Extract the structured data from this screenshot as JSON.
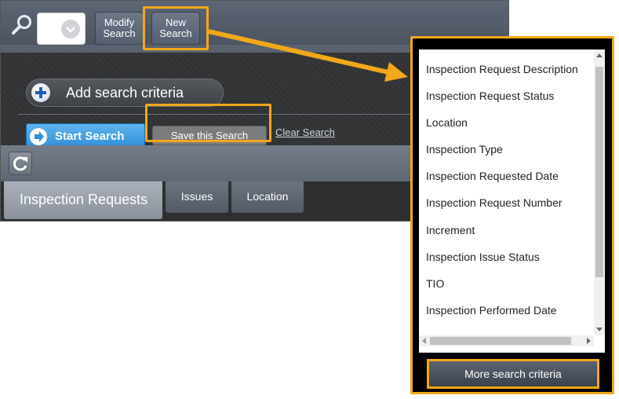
{
  "toolbar": {
    "modify_line1": "Modify",
    "modify_line2": "Search",
    "new_line1": "New",
    "new_line2": "Search"
  },
  "criteria": {
    "add_label": "Add search criteria",
    "start_label": "Start Search",
    "save_label": "Save this Search",
    "clear_label": "Clear Search"
  },
  "tabs": [
    {
      "label": "Inspection Requests"
    },
    {
      "label": "Issues"
    },
    {
      "label": "Location"
    }
  ],
  "popup": {
    "items": [
      "Inspection Request Description",
      "Inspection Request Status",
      "Location",
      "Inspection Type",
      "Inspection Requested Date",
      "Inspection Request Number",
      "Increment",
      "Inspection Issue Status",
      "TIO",
      "Inspection Performed Date"
    ],
    "more_label": "More search criteria"
  },
  "colors": {
    "highlight": "#f1a81a",
    "start_button": "#3b98e0"
  }
}
